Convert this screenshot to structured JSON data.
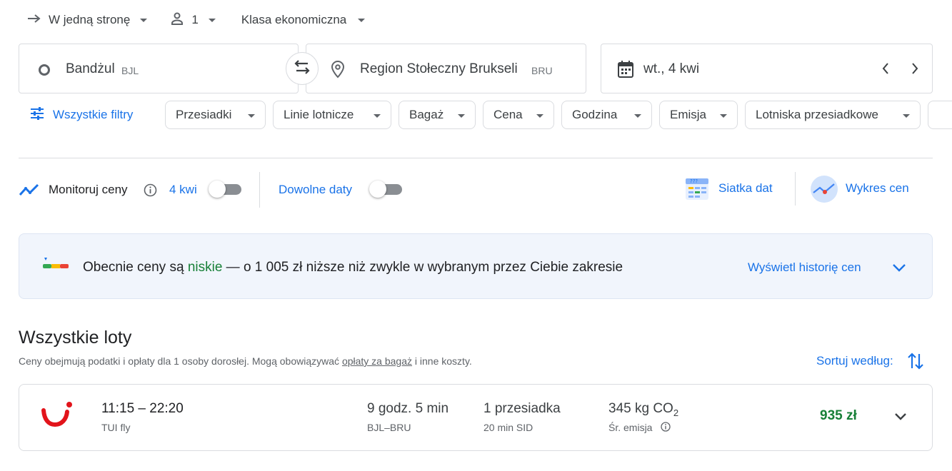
{
  "search_bar": {
    "trip_type": "W jedną stronę",
    "passengers": "1",
    "cabin_class": "Klasa ekonomiczna"
  },
  "origin": {
    "name": "Bandżul",
    "code": "BJL"
  },
  "destination": {
    "name": "Region Stołeczny Brukseli",
    "code": "BRU"
  },
  "date": {
    "value": "wt., 4 kwi"
  },
  "filters": {
    "all_filters": "Wszystkie filtry",
    "chips": [
      "Przesiadki",
      "Linie lotnicze",
      "Bagaż",
      "Cena",
      "Godzina",
      "Emisja",
      "Lotniska przesiadkowe"
    ]
  },
  "tools": {
    "track_prices": "Monitoruj ceny",
    "track_date": "4 kwi",
    "any_dates": "Dowolne daty",
    "date_grid": "Siatka dat",
    "price_graph": "Wykres cen"
  },
  "price_insight": {
    "prefix": "Obecnie ceny są",
    "level": "niskie",
    "suffix": "— o 1 005 zł niższe niż zwykle w wybranym przez Ciebie zakresie",
    "history_link": "Wyświetl historię cen"
  },
  "results": {
    "heading": "Wszystkie loty",
    "note_prefix": "Ceny obejmują podatki i opłaty dla 1 osoby dorosłej. Mogą obowiązywać",
    "note_link": "opłaty za bagaż",
    "note_suffix": "i inne koszty.",
    "sort_label": "Sortuj według:",
    "flights": [
      {
        "times": "11:15 – 22:20",
        "airline": "TUI fly",
        "duration": "9 godz. 5 min",
        "route": "BJL–BRU",
        "stops": "1 przesiadka",
        "layover": "20 min SID",
        "emissions": "345 kg CO",
        "emissions_sub": "2",
        "emissions_label": "Śr. emisja",
        "price": "935 zł"
      }
    ]
  },
  "colors": {
    "accent": "#1a73e8",
    "low_price": "#188038",
    "brand_tui": "#e2141b"
  }
}
